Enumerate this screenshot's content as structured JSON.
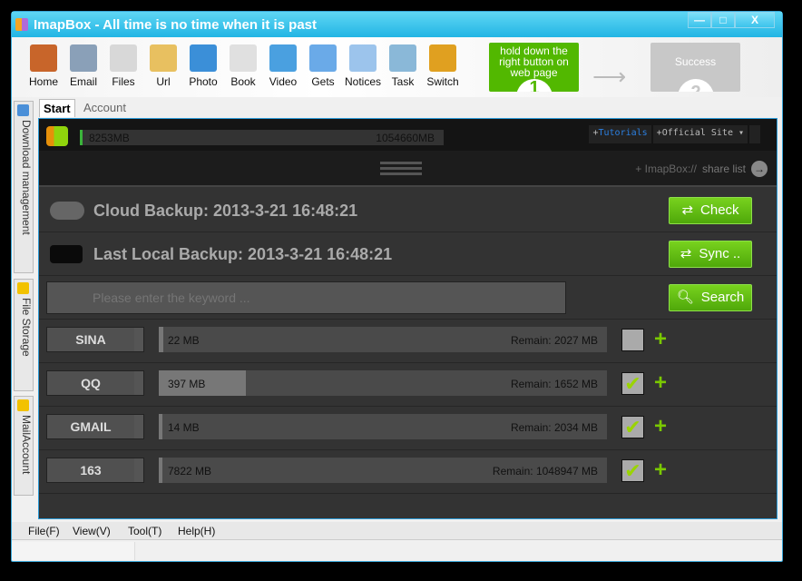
{
  "window": {
    "title": "ImapBox - All time is no time when it is past",
    "minimize": "—",
    "maximize": "□",
    "close": "X"
  },
  "toolbar": {
    "items": [
      {
        "label": "Home",
        "icon": "lighthouse-icon",
        "color": "#c8652a"
      },
      {
        "label": "Email",
        "icon": "database-email-icon",
        "color": "#8aa0b8"
      },
      {
        "label": "Files",
        "icon": "files-lock-icon",
        "color": "#d8d8d8"
      },
      {
        "label": "Url",
        "icon": "webpage-icon",
        "color": "#e8c060"
      },
      {
        "label": "Photo",
        "icon": "photo-icon",
        "color": "#3b8fd8"
      },
      {
        "label": "Book",
        "icon": "document-icon",
        "color": "#e0e0e0"
      },
      {
        "label": "Video",
        "icon": "film-icon",
        "color": "#4aa0e0"
      },
      {
        "label": "Gets",
        "icon": "download-icon",
        "color": "#6aaae8"
      },
      {
        "label": "Notices",
        "icon": "calendar-icon",
        "color": "#9cc4ec"
      },
      {
        "label": "Task",
        "icon": "task-icon",
        "color": "#8ab8d8"
      },
      {
        "label": "Switch",
        "icon": "padlock-icon",
        "color": "#e0a020"
      }
    ]
  },
  "steps": {
    "step1_text": "hold down the right button on web page",
    "step1_num": "1",
    "step2_text": "Success",
    "step2_num": "2"
  },
  "sidetabs": [
    "Download management",
    "File Storage",
    "MailAccount"
  ],
  "tabs": [
    {
      "label": "Start",
      "active": true
    },
    {
      "label": "Account",
      "active": false
    }
  ],
  "storage": {
    "used": "8253MB",
    "total": "1054660MB",
    "used_fraction": 0.0078
  },
  "links": {
    "tutorials_plus": "+",
    "tutorials": "Tutorials",
    "official": "+Official Site ▾"
  },
  "share": {
    "prefix": "+ ImapBox://",
    "label": "share list",
    "icon": "arrow-right-circle-icon"
  },
  "cloud_backup": {
    "label": "Cloud Backup: 2013-3-21 16:48:21",
    "button": "Check"
  },
  "local_backup": {
    "label": "Last Local Backup: 2013-3-21 16:48:21",
    "button": "Sync .."
  },
  "search": {
    "placeholder": "Please enter the keyword ...",
    "button": "Search"
  },
  "accounts": [
    {
      "name": "SINA",
      "used": "22 MB",
      "remain": "Remain: 2027 MB",
      "fraction": 0.0107,
      "checked": false
    },
    {
      "name": "QQ",
      "used": "397 MB",
      "remain": "Remain: 1652 MB",
      "fraction": 0.194,
      "checked": true
    },
    {
      "name": "GMAIL",
      "used": "14 MB",
      "remain": "Remain: 2034 MB",
      "fraction": 0.0068,
      "checked": true
    },
    {
      "name": "163",
      "used": "7822 MB",
      "remain": "Remain: 1048947 MB",
      "fraction": 0.0074,
      "checked": true
    }
  ],
  "menu": [
    "File(F)",
    "View(V)",
    "Tool(T)",
    "Help(H)"
  ],
  "colors": {
    "accent_green": "#52b800",
    "title_blue": "#22b5e4",
    "dark_bg": "#333333"
  }
}
